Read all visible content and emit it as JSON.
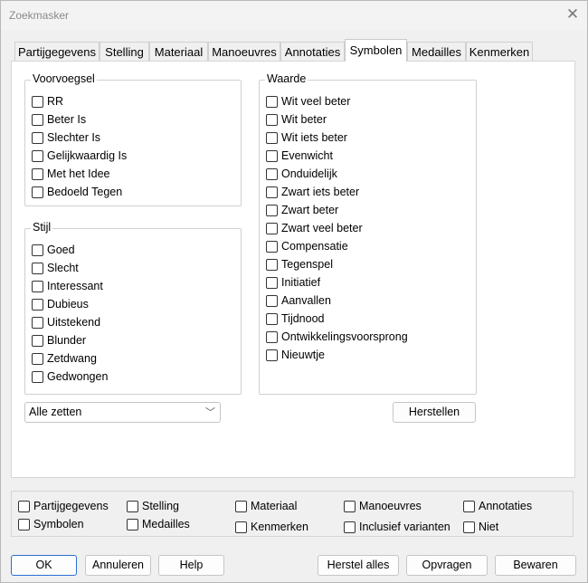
{
  "window": {
    "title": "Zoekmasker",
    "close_symbol": "✕"
  },
  "tabs": [
    {
      "label": "Partijgegevens"
    },
    {
      "label": "Stelling"
    },
    {
      "label": "Materiaal"
    },
    {
      "label": "Manoeuvres"
    },
    {
      "label": "Annotaties"
    },
    {
      "label": "Symbolen",
      "active": true
    },
    {
      "label": "Medailles"
    },
    {
      "label": "Kenmerken"
    }
  ],
  "voorvoegsel": {
    "legend": "Voorvoegsel",
    "items": [
      "RR",
      "Beter Is",
      "Slechter Is",
      "Gelijkwaardig Is",
      "Met het Idee",
      "Bedoeld Tegen"
    ]
  },
  "stijl": {
    "legend": "Stijl",
    "items": [
      "Goed",
      "Slecht",
      "Interessant",
      "Dubieus",
      "Uitstekend",
      "Blunder",
      "Zetdwang",
      "Gedwongen"
    ]
  },
  "waarde": {
    "legend": "Waarde",
    "items": [
      "Wit veel beter",
      "Wit beter",
      "Wit iets beter",
      "Evenwicht",
      "Onduidelijk",
      "Zwart iets beter",
      "Zwart beter",
      "Zwart veel beter",
      "Compensatie",
      "Tegenspel",
      "Initiatief",
      "Aanvallen",
      "Tijdnood",
      "Ontwikkelingsvoorsprong",
      "Nieuwtje"
    ]
  },
  "scope_dropdown": {
    "value": "Alle zetten",
    "chevron": "﹀"
  },
  "reset_button": "Herstellen",
  "filters": {
    "row1": [
      "Partijgegevens",
      "Stelling",
      "Materiaal",
      "Manoeuvres",
      "Annotaties"
    ],
    "row2": [
      "Symbolen",
      "Medailles",
      "Kenmerken",
      "Inclusief varianten",
      "Niet"
    ]
  },
  "footer": {
    "ok": "OK",
    "cancel": "Annuleren",
    "help": "Help",
    "reset_all": "Herstel alles",
    "query": "Opvragen",
    "save": "Bewaren"
  }
}
